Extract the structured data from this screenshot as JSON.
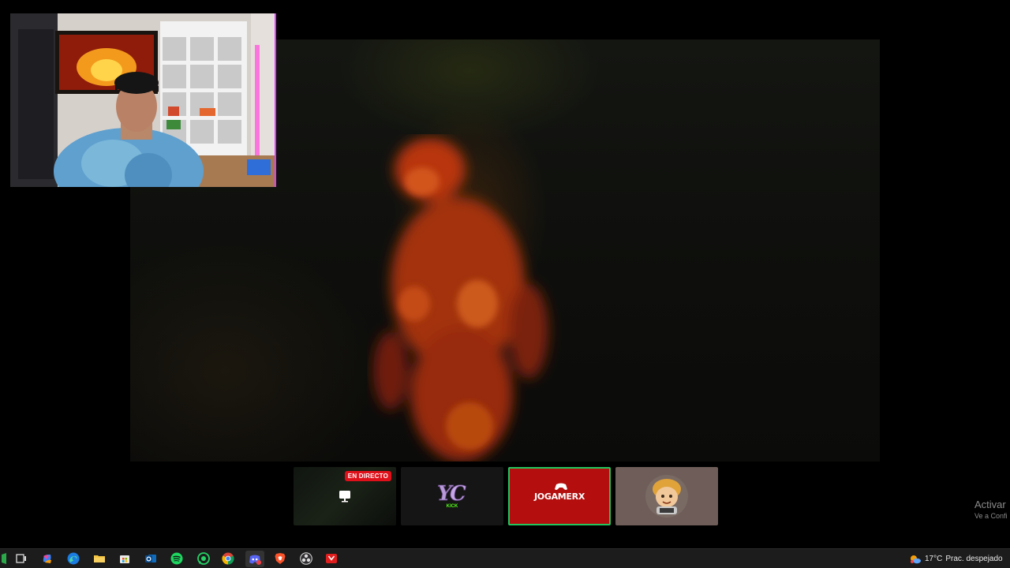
{
  "streams": {
    "live_badge": "EN DIRECTO",
    "kick_label": "KICK",
    "jogamerx_label": "JOGAMERX"
  },
  "watermark": {
    "title": "Activar",
    "subtitle": "Ve a Confi"
  },
  "taskbar": {
    "icons": [
      "start-icon",
      "task-view-icon",
      "copilot-icon",
      "edge-icon",
      "file-explorer-icon",
      "store-icon",
      "outlook-icon",
      "spotify-icon",
      "whatsapp-icon",
      "chrome-icon",
      "discord-icon",
      "brave-icon",
      "obs-icon",
      "video-app-icon"
    ],
    "weather_temp": "17°C",
    "weather_desc": "Prac. despejado"
  },
  "colors": {
    "live_badge": "#e0101a",
    "selected_border": "#22c55e",
    "jogamerx_bg": "#b40e0e",
    "webcam_border": "#e03cff",
    "taskbar_bg": "#1c1c1c"
  }
}
